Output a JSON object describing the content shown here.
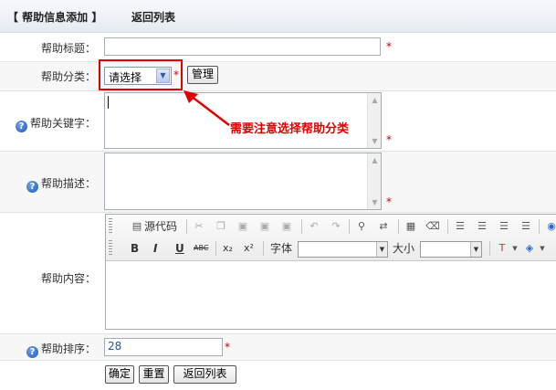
{
  "header": {
    "title": "【 帮助信息添加 】",
    "back_link": "返回列表"
  },
  "form": {
    "title_label": "帮助标题：",
    "category_label": "帮助分类：",
    "category_selected": "请选择",
    "manage_button": "管理",
    "keywords_label": "帮助关键字：",
    "description_label": "帮助描述：",
    "content_label": "帮助内容：",
    "sort_label": "帮助排序：",
    "sort_value": "28",
    "required_mark": "*"
  },
  "editor": {
    "source_button": "源代码",
    "font_label": "字体",
    "size_label": "大小",
    "bold": "B",
    "italic": "I",
    "underline": "U",
    "strike": "ABC",
    "sub": "x₂",
    "sup": "x²"
  },
  "annotation": "需要注意选择帮助分类",
  "buttons": {
    "confirm": "确定",
    "reset": "重置",
    "back": "返回列表"
  },
  "colors": {
    "annotation": "#e00000",
    "required": "#cc0000",
    "sort_value": "#1b5aa8"
  }
}
